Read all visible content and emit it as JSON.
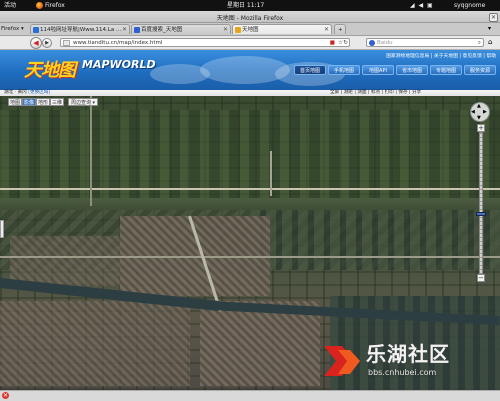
{
  "gnome_panel": {
    "activities": "活动",
    "app": "Firefox",
    "clock": "星期日 11:17",
    "user": "syqgnome"
  },
  "window": {
    "title": "天地图 - Mozilla Firefox"
  },
  "tabs": {
    "menu_label": "Firefox",
    "items": [
      {
        "label": "114啦网址导航|Www.114.La ..."
      },
      {
        "label": "百度搜索_天地图"
      },
      {
        "label": "天地图"
      }
    ],
    "new_tab": "+"
  },
  "nav": {
    "url": "www.tianditu.cn/map/index.html",
    "search_placeholder": "Baidu"
  },
  "header": {
    "logo_cn": "天地图",
    "logo_en": "MAPWORLD",
    "links": "国家测绘地理信息局 | 关于天地图 | 意见反馈 | 帮助",
    "buttons": [
      "首页地图",
      "手机地图",
      "地图API",
      "省市地图",
      "专题地图",
      "服务资源"
    ]
  },
  "toolbar": {
    "location": "湖北 · 黄冈",
    "switch_city": "[更换区域]",
    "tools": [
      "全屏",
      "测距",
      "测面",
      "标点",
      "打印",
      "保存",
      "分享"
    ]
  },
  "map": {
    "types": [
      "地图",
      "影像",
      "地形",
      "三维"
    ],
    "active_type": "影像",
    "search_label": "周边查询",
    "zoom_plus": "+",
    "zoom_minus": "−",
    "zoom_level_fraction": 0.42
  },
  "watermark": {
    "brand": "乐湖社区",
    "url": "bbs.cnhubei.com"
  },
  "colors": {
    "header_blue": "#1f6dbf",
    "logo_yellow": "#ffd21a",
    "active_blue": "#3d75c4"
  }
}
